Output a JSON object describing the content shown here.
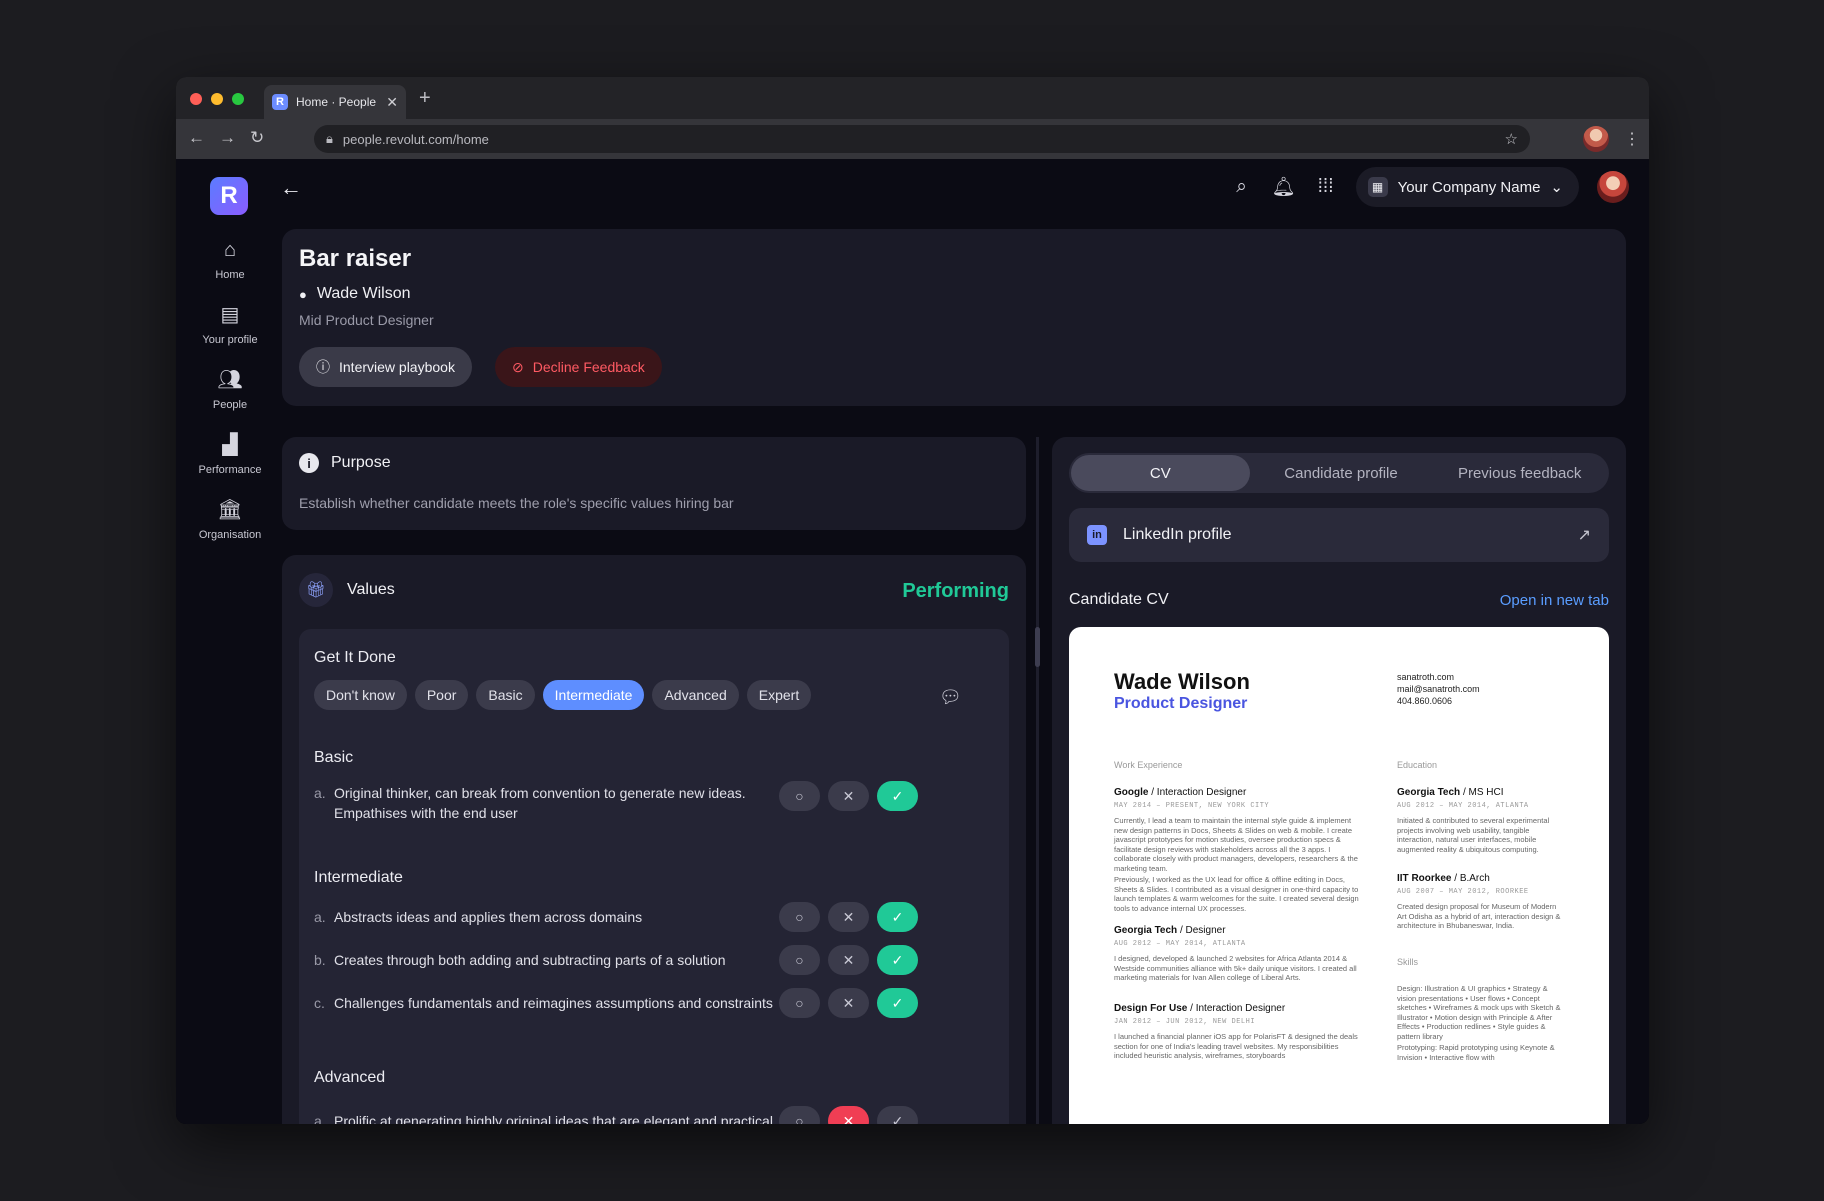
{
  "browser": {
    "tab_title": "Home · People",
    "favicon_letter": "R",
    "url": "people.revolut.com/home",
    "new_tab_label": "+",
    "close_label": "✕",
    "traffic_light_colors": [
      "#ff5f57",
      "#febc2e",
      "#28c840"
    ]
  },
  "app": {
    "logo_letter": "R",
    "company_name": "Your Company Name",
    "sidebar": [
      {
        "label": "Home",
        "icon": "home-icon"
      },
      {
        "label": "Your profile",
        "icon": "id-card-icon"
      },
      {
        "label": "People",
        "icon": "people-icon"
      },
      {
        "label": "Performance",
        "icon": "chart-icon"
      },
      {
        "label": "Organisation",
        "icon": "bank-icon"
      }
    ]
  },
  "header": {
    "title": "Bar raiser",
    "candidate_name": "Wade Wilson",
    "role": "Mid Product Designer",
    "playbook_label": "Interview playbook",
    "decline_label": "Decline Feedback"
  },
  "purpose": {
    "title": "Purpose",
    "description": "Establish whether candidate meets the role's specific values hiring bar"
  },
  "values": {
    "title": "Values",
    "status": "Performing",
    "status_color": "#20c997",
    "group_title": "Get It Done",
    "levels": [
      "Don't know",
      "Poor",
      "Basic",
      "Intermediate",
      "Advanced",
      "Expert"
    ],
    "selected_level": "Intermediate",
    "sections": [
      {
        "title": "Basic",
        "items": [
          {
            "mark": "a.",
            "text": "Original thinker, can break from convention to generate new ideas. Empathises with the end user",
            "result": "yes"
          }
        ]
      },
      {
        "title": "Intermediate",
        "items": [
          {
            "mark": "a.",
            "text": "Abstracts ideas and applies them across domains",
            "result": "yes"
          },
          {
            "mark": "b.",
            "text": "Creates through both adding and subtracting parts of a solution",
            "result": "yes"
          },
          {
            "mark": "c.",
            "text": "Challenges fundamentals and reimagines assumptions and constraints",
            "result": "yes"
          }
        ]
      },
      {
        "title": "Advanced",
        "items": [
          {
            "mark": "a.",
            "text": "Prolific at generating highly original ideas that are elegant and practical",
            "result": "no"
          }
        ]
      }
    ]
  },
  "right_panel": {
    "tabs": [
      "CV",
      "Candidate profile",
      "Previous feedback"
    ],
    "active_tab": "CV",
    "linkedin_label": "LinkedIn profile",
    "linkedin_badge": "in",
    "cv_title": "Candidate CV",
    "open_new_tab": "Open in new tab"
  },
  "cv": {
    "name": "Wade Wilson",
    "title": "Product Designer",
    "contact": [
      "sanatroth.com",
      "mail@sanatroth.com",
      "404.860.0606"
    ],
    "work_heading": "Work Experience",
    "education_heading": "Education",
    "skills_heading": "Skills",
    "jobs": [
      {
        "company": "Google",
        "role": "Interaction Designer",
        "dates": "MAY 2014 – PRESENT, NEW YORK CITY",
        "text": "Currently, I lead a team to maintain the internal style guide & implement new design patterns in Docs, Sheets & Slides on web & mobile. I create javascript prototypes for motion studies, oversee production specs & facilitate design reviews with stakeholders across all the 3 apps. I collaborate closely with product managers, developers, researchers & the marketing team."
      },
      {
        "company": "",
        "role": "",
        "dates": "",
        "text": "Previously, I worked as the UX lead for office & offline editing in Docs, Sheets & Slides. I contributed as a visual designer in one-third capacity to launch templates & warm welcomes for the suite. I created several design tools to advance internal UX processes."
      },
      {
        "company": "Georgia Tech",
        "role": "Designer",
        "dates": "AUG 2012 – MAY 2014, ATLANTA",
        "text": "I designed, developed & launched 2 websites for Africa Atlanta 2014 & Westside communities alliance with 5k+ daily unique visitors. I created all marketing materials for Ivan Allen college of Liberal Arts."
      },
      {
        "company": "Design For Use",
        "role": "Interaction Designer",
        "dates": "JAN 2012 – JUN 2012, NEW DELHI",
        "text": "I launched a financial planner iOS app for PolarisFT & designed the deals section for one of India's leading travel websites. My responsibilities included heuristic analysis, wireframes, storyboards"
      }
    ],
    "education": [
      {
        "school": "Georgia Tech",
        "degree": "MS HCI",
        "dates": "AUG 2012 – MAY 2014, ATLANTA",
        "text": "Initiated & contributed to several experimental projects involving web usability, tangible interaction, natural user interfaces, mobile augmented reality & ubiquitous computing."
      },
      {
        "school": "IIT Roorkee",
        "degree": "B.Arch",
        "dates": "AUG 2007 – MAY 2012, ROORKEE",
        "text": "Created design proposal for Museum of Modern Art Odisha as a hybrid of art, interaction design & architecture in Bhubaneswar, India."
      }
    ],
    "skills_design": "Design: Illustration & UI graphics • Strategy & vision presentations • User flows • Concept sketches • Wireframes & mock ups with Sketch & Illustrator • Motion design with Principle & After Effects • Production redlines • Style guides & pattern library",
    "skills_proto": "Prototyping: Rapid prototyping using Keynote & Invision • Interactive flow with"
  }
}
